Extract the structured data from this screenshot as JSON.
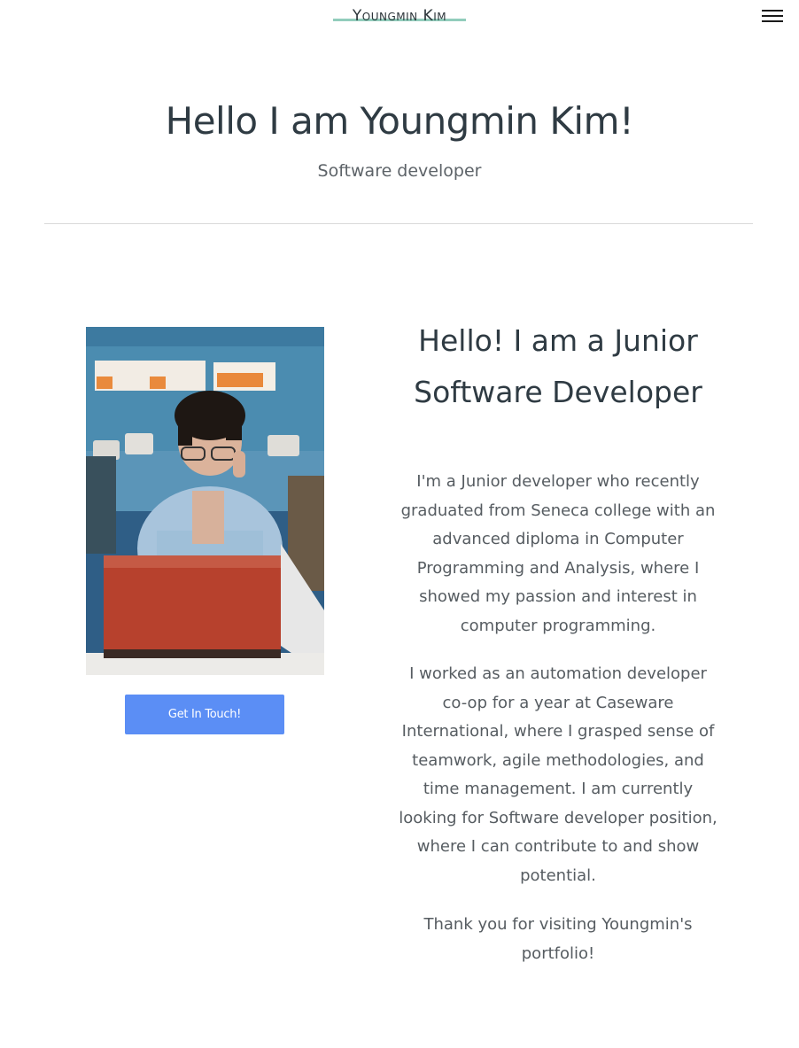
{
  "header": {
    "logo_text": "Youngmin Kim",
    "menu_icon": "hamburger-menu-icon"
  },
  "hero": {
    "title": "Hello I am Youngmin Kim!",
    "subtitle": "Software developer"
  },
  "about": {
    "photo_alt": "Youngmin Kim working at a laptop",
    "cta_label": "Get In Touch!",
    "heading_line1": "Hello! I am a Junior",
    "heading_line2": "Software Developer",
    "paragraph1": "I'm a Junior developer who recently graduated from Seneca college with an advanced diploma in Computer Programming and Analysis, where I showed my passion and interest in computer programming.",
    "paragraph2": "I worked as an automation developer co-op for a year at Caseware International, where I grasped sense of teamwork, agile methodologies, and time management. I am currently looking for Software developer position, where I can contribute to and show potential.",
    "paragraph3": "Thank you for visiting Youngmin's portfolio!"
  },
  "colors": {
    "accent_button": "#5b8ef5",
    "logo_underline": "#7fc4b0",
    "heading_text": "#2f3b43",
    "body_text": "#565c61"
  }
}
